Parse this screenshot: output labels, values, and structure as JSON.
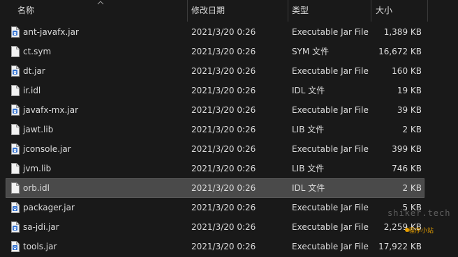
{
  "columns": {
    "name": "名称",
    "date": "修改日期",
    "type": "类型",
    "size": "大小"
  },
  "files": [
    {
      "name": "ant-javafx.jar",
      "date": "2021/3/20 0:26",
      "type": "Executable Jar File",
      "size": "1,389 KB",
      "icon": "jar-file-icon"
    },
    {
      "name": "ct.sym",
      "date": "2021/3/20 0:26",
      "type": "SYM 文件",
      "size": "16,672 KB",
      "icon": "blank-file-icon"
    },
    {
      "name": "dt.jar",
      "date": "2021/3/20 0:26",
      "type": "Executable Jar File",
      "size": "160 KB",
      "icon": "jar-file-icon"
    },
    {
      "name": "ir.idl",
      "date": "2021/3/20 0:26",
      "type": "IDL 文件",
      "size": "19 KB",
      "icon": "blank-file-icon"
    },
    {
      "name": "javafx-mx.jar",
      "date": "2021/3/20 0:26",
      "type": "Executable Jar File",
      "size": "39 KB",
      "icon": "jar-file-icon"
    },
    {
      "name": "jawt.lib",
      "date": "2021/3/20 0:26",
      "type": "LIB 文件",
      "size": "2 KB",
      "icon": "blank-file-icon"
    },
    {
      "name": "jconsole.jar",
      "date": "2021/3/20 0:26",
      "type": "Executable Jar File",
      "size": "399 KB",
      "icon": "jar-file-icon"
    },
    {
      "name": "jvm.lib",
      "date": "2021/3/20 0:26",
      "type": "LIB 文件",
      "size": "746 KB",
      "icon": "blank-file-icon"
    },
    {
      "name": "orb.idl",
      "date": "2021/3/20 0:26",
      "type": "IDL 文件",
      "size": "2 KB",
      "icon": "blank-file-icon",
      "selected": true
    },
    {
      "name": "packager.jar",
      "date": "2021/3/20 0:26",
      "type": "Executable Jar File",
      "size": "5 KB",
      "icon": "jar-file-icon"
    },
    {
      "name": "sa-jdi.jar",
      "date": "2021/3/20 0:26",
      "type": "Executable Jar File",
      "size": "2,259 KB",
      "icon": "jar-file-icon"
    },
    {
      "name": "tools.jar",
      "date": "2021/3/20 0:26",
      "type": "Executable Jar File",
      "size": "17,922 KB",
      "icon": "jar-file-icon"
    }
  ],
  "watermark": {
    "text": "shiker.tech",
    "badge": "程序小站"
  },
  "colors": {
    "background": "#191919",
    "selected_row": "#4a4a4a",
    "text": "#dcdcdc",
    "separator": "#3a3a3a",
    "jar_icon_accent": "#2f6fcf"
  }
}
